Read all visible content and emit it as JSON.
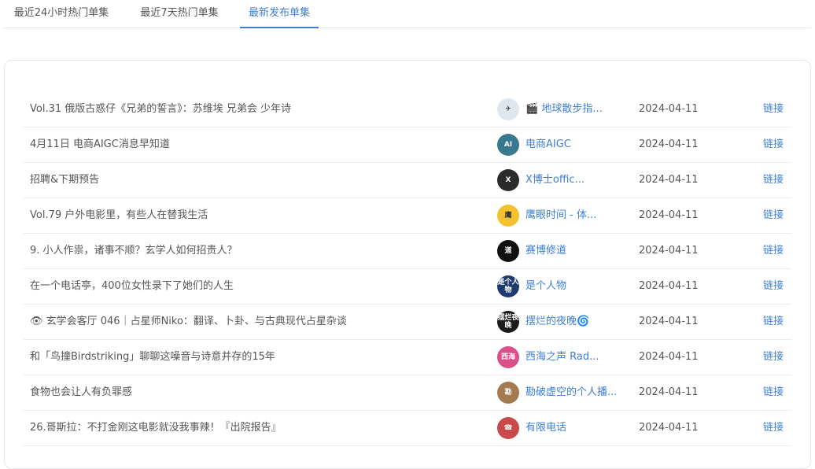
{
  "tabs": [
    {
      "label": "最近24小时热门单集"
    },
    {
      "label": "最近7天热门单集"
    },
    {
      "label": "最新发布单集"
    }
  ],
  "link_label": "链接",
  "episodes": [
    {
      "title": "Vol.31 俄版古惑仔《兄弟的誓言》：苏维埃 兄弟会 少年诗",
      "podcast": "🎬 地球散步指...",
      "date": "2024-04-11",
      "avatar_text": "✈",
      "avatar_color": "#dfe6ee"
    },
    {
      "title": "4月11日 电商AIGC消息早知道",
      "podcast": "电商AIGC",
      "date": "2024-04-11",
      "avatar_text": "AI",
      "avatar_color": "#3a7890"
    },
    {
      "title": "招聘&下期预告",
      "podcast": "X博士offic...",
      "date": "2024-04-11",
      "avatar_text": "X",
      "avatar_color": "#2b2b2b"
    },
    {
      "title": "Vol.79 户外电影里，有些人在替我生活",
      "podcast": "鹰眼时间 - 体...",
      "date": "2024-04-11",
      "avatar_text": "鹰",
      "avatar_color": "#f2c230"
    },
    {
      "title": "9. 小人作祟，诸事不顺？玄学人如何招贵人？",
      "podcast": "赛博修道",
      "date": "2024-04-11",
      "avatar_text": "道",
      "avatar_color": "#111111"
    },
    {
      "title": "在一个电话亭，400位女性录下了她们的人生",
      "podcast": "是个人物",
      "date": "2024-04-11",
      "avatar_text": "是个人物",
      "avatar_color": "#1f3a6e"
    },
    {
      "title": "👁 玄学会客厅 046｜占星师Niko：翻译、卜卦、与古典现代占星杂谈",
      "podcast": "摆烂的夜晚🌀",
      "date": "2024-04-11",
      "avatar_text": "摆烂夜晚",
      "avatar_color": "#1b1b1b"
    },
    {
      "title": "和「鸟撞Birdstriking」聊聊这噪音与诗意并存的15年",
      "podcast": "西海之声 Rad...",
      "date": "2024-04-11",
      "avatar_text": "西海",
      "avatar_color": "#d9508a"
    },
    {
      "title": "食物也会让人有负罪感",
      "podcast": "勘破虚空的个人播...",
      "date": "2024-04-11",
      "avatar_text": "勘",
      "avatar_color": "#a47a52"
    },
    {
      "title": "26.哥斯拉：不打金刚这电影就没我事辣！『出院报告』",
      "podcast": "有限电话",
      "date": "2024-04-11",
      "avatar_text": "☎",
      "avatar_color": "#c84a4a"
    }
  ]
}
